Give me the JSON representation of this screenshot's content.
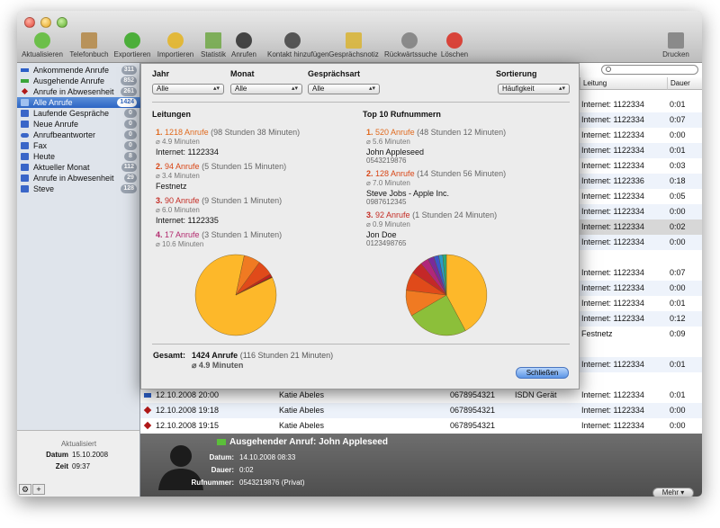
{
  "toolbar": [
    {
      "label": "Aktualisieren",
      "icon": "refresh-icon",
      "color": "#6cbf4a"
    },
    {
      "label": "Telefonbuch",
      "icon": "phonebook-icon",
      "color": "#b8925a"
    },
    {
      "label": "Exportieren",
      "icon": "export-icon",
      "color": "#4cae3a"
    },
    {
      "label": "Importieren",
      "icon": "import-icon",
      "color": "#e2b83a"
    },
    {
      "label": "Statistik",
      "icon": "statistics-icon",
      "color": "#7eae5a"
    },
    {
      "label": "Anrufen",
      "icon": "phone-icon",
      "color": "#444444"
    },
    {
      "label": "Kontakt hinzufügen",
      "icon": "add-contact-icon",
      "color": "#555555"
    },
    {
      "label": "Gesprächsnotiz",
      "icon": "pencil-icon",
      "color": "#d8b84a"
    },
    {
      "label": "Rückwärtssuche",
      "icon": "magnifier-icon",
      "color": "#8a8a8a"
    },
    {
      "label": "Löschen",
      "icon": "delete-icon",
      "color": "#d8443a"
    },
    {
      "label": "Drucken",
      "icon": "printer-icon",
      "color": "#8a8a8a"
    }
  ],
  "sidebar": {
    "items": [
      {
        "label": "Ankommende Anrufe",
        "badge": "311",
        "icon": "incoming-arrow-icon",
        "color": "#2d5fc8"
      },
      {
        "label": "Ausgehende Anrufe",
        "badge": "852",
        "icon": "outgoing-arrow-icon",
        "color": "#3aa53a"
      },
      {
        "label": "Anrufe in Abwesenheit",
        "badge": "261",
        "icon": "missed-diamond-icon",
        "color": "#b01818"
      },
      {
        "label": "Alle Anrufe",
        "badge": "1424",
        "icon": "folder-icon",
        "color": "#3a66c8"
      },
      {
        "label": "Laufende Gespräche",
        "badge": "0",
        "icon": "folder-icon",
        "color": "#3a66c8"
      },
      {
        "label": "Neue Anrufe",
        "badge": "0",
        "icon": "folder-icon",
        "color": "#3a66c8"
      },
      {
        "label": "Anrufbeantworter",
        "badge": "0",
        "icon": "voicemail-icon",
        "color": "#3a66c8"
      },
      {
        "label": "Fax",
        "badge": "0",
        "icon": "folder-icon",
        "color": "#3a66c8"
      },
      {
        "label": "Heute",
        "badge": "8",
        "icon": "folder-icon",
        "color": "#3a66c8"
      },
      {
        "label": "Aktueller Monat",
        "badge": "112",
        "icon": "folder-icon",
        "color": "#3a66c8"
      },
      {
        "label": "Anrufe in Abwesenheit",
        "badge": "29",
        "icon": "folder-icon",
        "color": "#3a66c8"
      },
      {
        "label": "Steve",
        "badge": "128",
        "icon": "folder-icon",
        "color": "#3a66c8"
      }
    ],
    "status": {
      "title": "Aktualisiert",
      "date_label": "Datum",
      "date": "15.10.2008",
      "time_label": "Zeit",
      "time": "09:37"
    }
  },
  "table": {
    "headers": [
      "Leitung",
      "Dauer"
    ],
    "rows": [
      {
        "line": "Internet: 1122334",
        "duration": "0:01"
      },
      {
        "line": "Internet: 1122334",
        "duration": "0:07"
      },
      {
        "line": "Internet: 1122334",
        "duration": "0:00"
      },
      {
        "line": "Internet: 1122334",
        "duration": "0:01"
      },
      {
        "line": "Internet: 1122334",
        "duration": "0:03"
      },
      {
        "line": "Internet: 1122336",
        "duration": "0:18"
      },
      {
        "line": "Internet: 1122334",
        "duration": "0:05"
      },
      {
        "line": "Internet: 1122334",
        "duration": "0:00"
      },
      {
        "line": "Internet: 1122334",
        "duration": "0:02"
      },
      {
        "line": "Internet: 1122334",
        "duration": "0:00"
      },
      {
        "line": "Internet: 1122334",
        "duration": "0:07"
      },
      {
        "line": "Internet: 1122334",
        "duration": "0:00"
      },
      {
        "line": "Internet: 1122334",
        "duration": "0:01"
      },
      {
        "line": "Internet: 1122334",
        "duration": "0:12"
      },
      {
        "line": "Festnetz",
        "duration": "0:09"
      },
      {
        "line": "Internet: 1122334",
        "duration": "0:01"
      }
    ],
    "bottom_rows": [
      {
        "date": "12.10.2008 20:00",
        "name": "Katie Abeles",
        "number": "0678954321",
        "line_a": "ISDN Gerät",
        "line": "Internet: 1122334",
        "duration": "0:01"
      },
      {
        "date": "12.10.2008 19:18",
        "name": "Katie Abeles",
        "number": "0678954321",
        "line_a": "",
        "line": "Internet: 1122334",
        "duration": "0:00"
      },
      {
        "date": "12.10.2008 19:15",
        "name": "Katie Abeles",
        "number": "0678954321",
        "line_a": "",
        "line": "Internet: 1122334",
        "duration": "0:00"
      }
    ]
  },
  "detail": {
    "title": "Ausgehender Anruf: John Appleseed",
    "date_label": "Datum:",
    "date": "14.10.2008 08:33",
    "duration_label": "Dauer:",
    "duration": "0:02",
    "number_label": "Rufnummer:",
    "number": "0543219876 (Privat)",
    "more": "Mehr"
  },
  "stats": {
    "filters": {
      "year_label": "Jahr",
      "year_value": "Alle",
      "month_label": "Monat",
      "month_value": "Alle",
      "type_label": "Gesprächsart",
      "type_value": "Alle",
      "sort_label": "Sortierung",
      "sort_value": "Häufigkeit"
    },
    "lines_title": "Leitungen",
    "top_title": "Top 10 Rufnummern",
    "lines": [
      {
        "rank": "1.",
        "calls": "1218 Anrufe",
        "time": "(98 Stunden 38 Minuten)",
        "avg": "⌀ 4.9 Minuten",
        "name": "Internet: 1122334"
      },
      {
        "rank": "2.",
        "calls": "94 Anrufe",
        "time": "(5 Stunden 15 Minuten)",
        "avg": "⌀ 3.4 Minuten",
        "name": "Festnetz"
      },
      {
        "rank": "3.",
        "calls": "90 Anrufe",
        "time": "(9 Stunden 1 Minuten)",
        "avg": "⌀ 6.0 Minuten",
        "name": "Internet: 1122335"
      },
      {
        "rank": "4.",
        "calls": "17 Anrufe",
        "time": "(3 Stunden 1 Minuten)",
        "avg": "⌀ 10.6 Minuten",
        "name": ""
      }
    ],
    "top": [
      {
        "rank": "1.",
        "calls": "520 Anrufe",
        "time": "(48 Stunden 12 Minuten)",
        "avg": "⌀ 5.6 Minuten",
        "name": "John Appleseed",
        "number": "0543219876"
      },
      {
        "rank": "2.",
        "calls": "128 Anrufe",
        "time": "(14 Stunden 56 Minuten)",
        "avg": "⌀ 7.0 Minuten",
        "name": "Steve Jobs - Apple Inc.",
        "number": "0987612345"
      },
      {
        "rank": "3.",
        "calls": "92 Anrufe",
        "time": "(1 Stunden 24 Minuten)",
        "avg": "⌀ 0.9 Minuten",
        "name": "Jon Doe",
        "number": "0123498765"
      }
    ],
    "total_label": "Gesamt:",
    "total_value": "1424 Anrufe",
    "total_time": "(116 Stunden 21 Minuten)",
    "total_avg": "⌀ 4.9 Minuten",
    "close": "Schließen",
    "pie_lines": [
      {
        "value": 1218,
        "color": "#fdb82a"
      },
      {
        "value": 94,
        "color": "#f07a22"
      },
      {
        "value": 90,
        "color": "#e04a1a"
      },
      {
        "value": 17,
        "color": "#c42020"
      },
      {
        "value": 5,
        "color": "#701010"
      }
    ],
    "pie_top": [
      {
        "value": 520,
        "color": "#fdb82a"
      },
      {
        "value": 300,
        "color": "#8cbf3a"
      },
      {
        "value": 128,
        "color": "#f07a22"
      },
      {
        "value": 92,
        "color": "#e04a1a"
      },
      {
        "value": 60,
        "color": "#c42828"
      },
      {
        "value": 40,
        "color": "#b0267a"
      },
      {
        "value": 30,
        "color": "#7a2a9a"
      },
      {
        "value": 25,
        "color": "#3a56c8"
      },
      {
        "value": 20,
        "color": "#2a9ac8"
      },
      {
        "value": 18,
        "color": "#2aaa7a"
      }
    ]
  }
}
